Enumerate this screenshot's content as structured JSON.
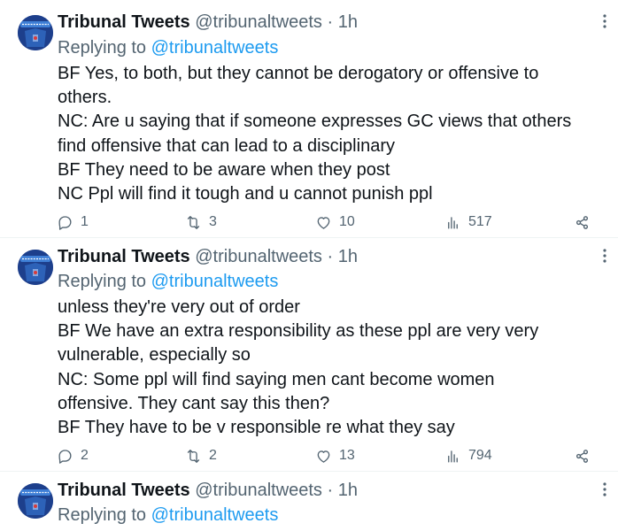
{
  "tweets": [
    {
      "name": "Tribunal Tweets",
      "handle": "@tribunaltweets",
      "time": "1h",
      "replying_prefix": "Replying to",
      "replying_to": "@tribunaltweets",
      "lines": [
        "BF Yes, to both, but they cannot be derogatory or offensive to",
        "others.",
        "NC: Are u saying that if someone expresses GC views that others",
        "find offensive that can lead to a disciplinary",
        "BF They need to be aware when they post",
        "NC Ppl will find it tough and u cannot punish ppl"
      ],
      "replies": "1",
      "retweets": "3",
      "likes": "10",
      "views": "517"
    },
    {
      "name": "Tribunal Tweets",
      "handle": "@tribunaltweets",
      "time": "1h",
      "replying_prefix": "Replying to",
      "replying_to": "@tribunaltweets",
      "lines": [
        "unless they're very out of order",
        "BF We have an extra responsibility as these ppl are very very",
        "vulnerable, especially so",
        "NC: Some ppl will find saying men cant become women",
        "offensive. They cant say this then?",
        "BF They have to be v responsible re what they say"
      ],
      "replies": "2",
      "retweets": "2",
      "likes": "13",
      "views": "794"
    },
    {
      "name": "Tribunal Tweets",
      "handle": "@tribunaltweets",
      "time": "1h",
      "replying_prefix": "Replying to",
      "replying_to": "@tribunaltweets"
    }
  ],
  "colors": {
    "text": "#0f1419",
    "secondary": "#536471",
    "link": "#1d9bf0",
    "avatar_bg": "#1d3f8c"
  },
  "icons": [
    "more-icon",
    "reply-icon",
    "retweet-icon",
    "like-icon",
    "views-icon",
    "share-icon"
  ]
}
